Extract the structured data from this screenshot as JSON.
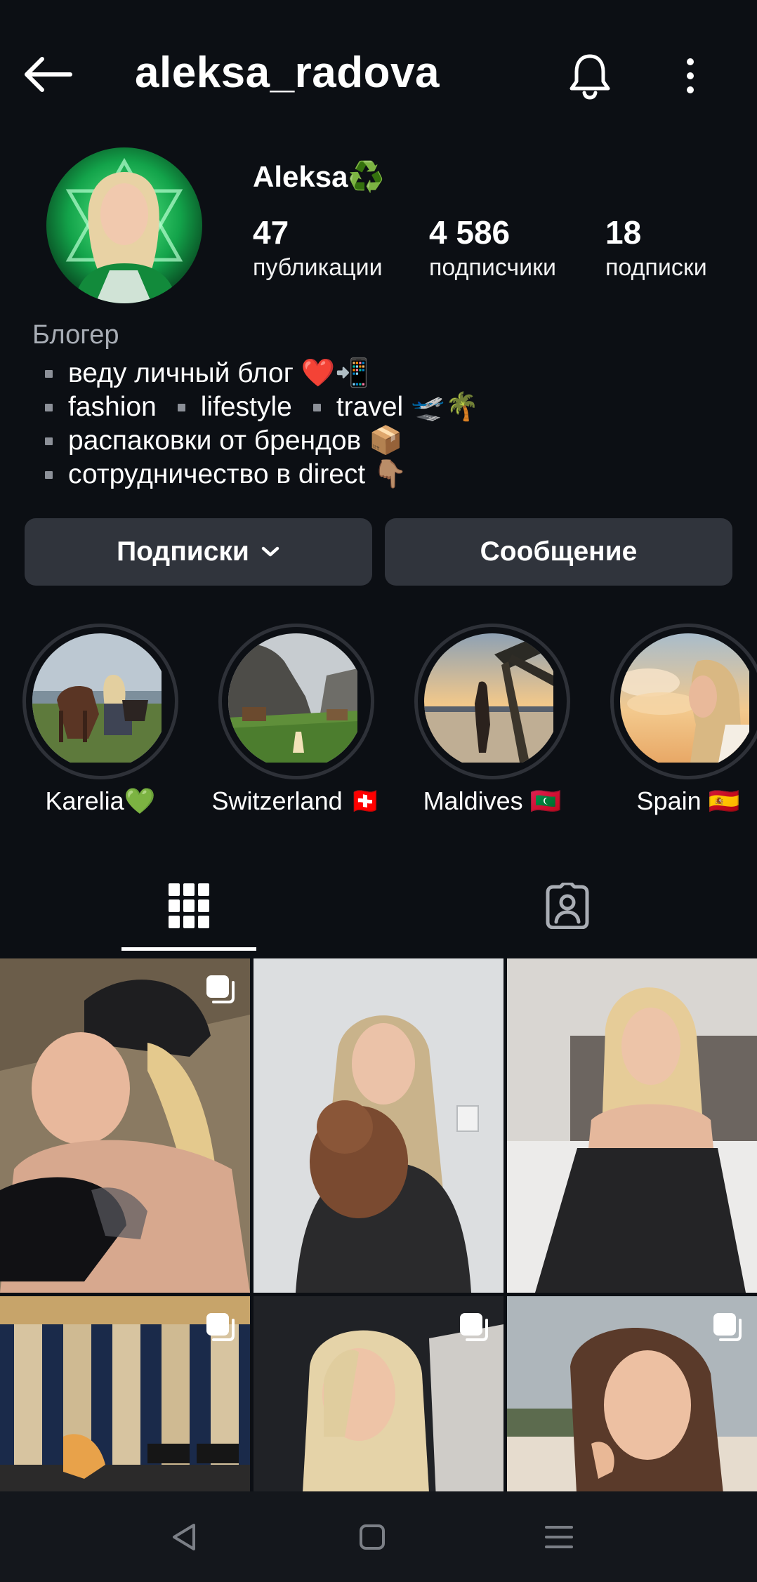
{
  "header": {
    "username": "aleksa_radova",
    "back_icon": "arrow-left-icon",
    "bell_icon": "bell-icon",
    "more_icon": "more-vertical-icon"
  },
  "profile": {
    "display_name": "Aleksa♻️",
    "stats": [
      {
        "value": "47",
        "label": "публикации"
      },
      {
        "value": "4 586",
        "label": "подписчики"
      },
      {
        "value": "18",
        "label": "подписки"
      }
    ],
    "category": "Блогер",
    "bio": {
      "line1": "веду личный блог ❤️📲",
      "line2_a": "fashion",
      "line2_b": "lifestyle",
      "line2_c": "travel 🛫🌴",
      "line3": "распаковки от брендов 📦",
      "line4": "сотрудничество в direct 👇🏽"
    }
  },
  "actions": {
    "following_label": "Подписки",
    "message_label": "Сообщение"
  },
  "highlights": [
    {
      "label": "Karelia💚"
    },
    {
      "label": "Switzerland 🇨🇭"
    },
    {
      "label": "Maldives 🇲🇻"
    },
    {
      "label": "Spain 🇪🇸"
    }
  ],
  "tabs": {
    "grid_icon": "grid-icon",
    "tagged_icon": "tagged-person-icon"
  },
  "colors": {
    "background": "#0c0f14",
    "button": "#30343c",
    "avatar_accent": "#1db954"
  }
}
